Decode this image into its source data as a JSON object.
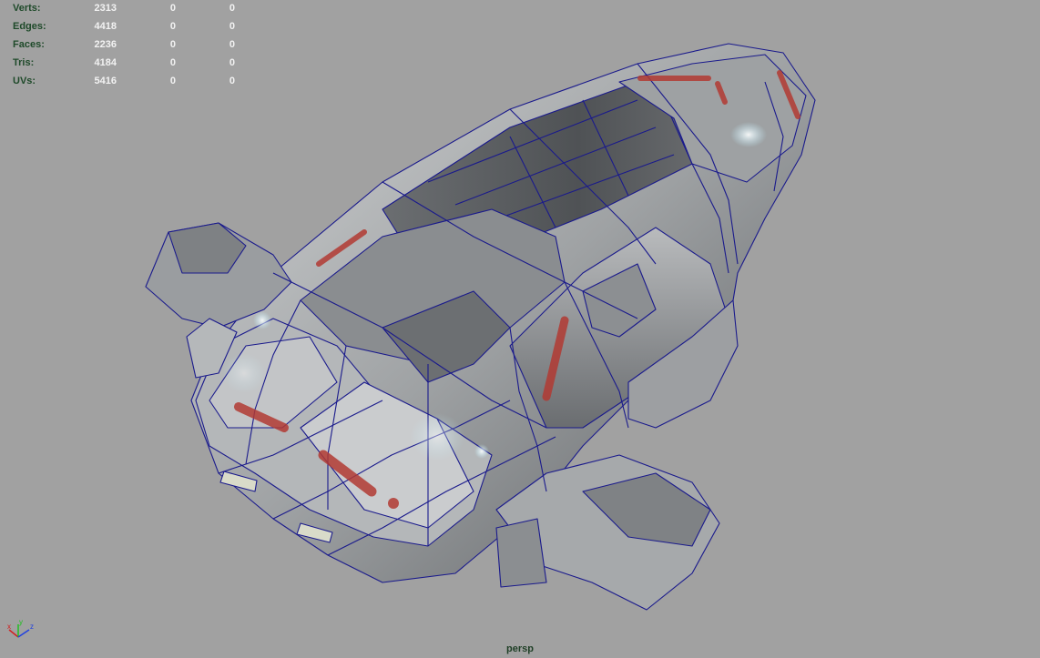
{
  "hud": {
    "stats": [
      {
        "label": "Verts:",
        "v1": "2313",
        "v2": "0",
        "v3": "0"
      },
      {
        "label": "Edges:",
        "v1": "4418",
        "v2": "0",
        "v3": "0"
      },
      {
        "label": "Faces:",
        "v1": "2236",
        "v2": "0",
        "v3": "0"
      },
      {
        "label": "Tris:",
        "v1": "4184",
        "v2": "0",
        "v3": "0"
      },
      {
        "label": "UVs:",
        "v1": "5416",
        "v2": "0",
        "v3": "0"
      }
    ]
  },
  "camera": {
    "label": "persp"
  },
  "axis": {
    "x_label": "x",
    "y_label": "y",
    "z_label": "z",
    "x_color": "#d22020",
    "y_color": "#20c020",
    "z_color": "#2040e0"
  },
  "colors": {
    "background": "#a1a1a1",
    "hull_light": "#c8cacb",
    "hull_mid": "#8e9193",
    "hull_dark": "#4b4d50",
    "wireframe": "#1a1a8c",
    "red_stripe": "#b23a32",
    "glow": "#bfefff"
  }
}
